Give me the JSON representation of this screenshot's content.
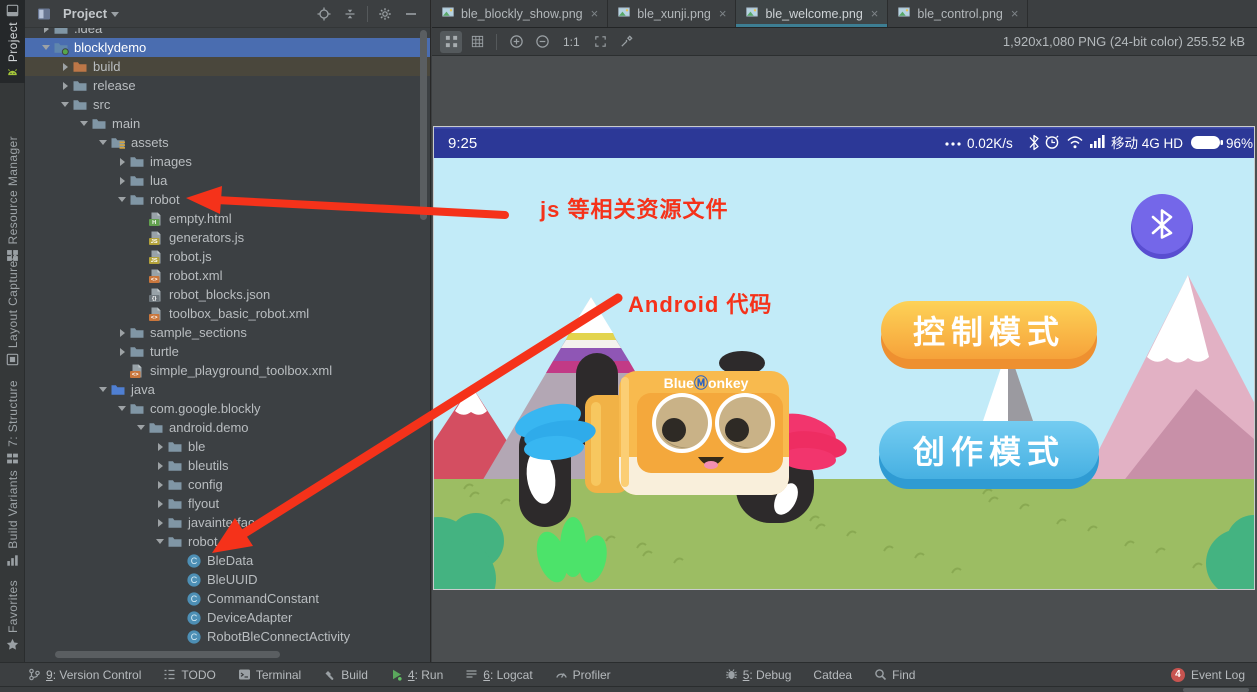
{
  "colors": {
    "annotation_red": "#f5321a",
    "selection_blue": "#4a6db0",
    "tab_underline_teal": "#3d7e93",
    "status_bar_indigo": "#2c3897",
    "button_orange": "#f6a73a",
    "button_blue": "#4cb4e5",
    "bluetooth_purple": "#7467e9",
    "event_badge_red": "#c75450"
  },
  "left_strip": {
    "items": [
      {
        "label": "Project",
        "icon": "android",
        "active": true
      },
      {
        "label": "Resource Manager",
        "icon": "resource-manager",
        "active": false
      },
      {
        "label": "Layout Captures",
        "icon": "layout-captures",
        "active": false
      },
      {
        "label": "7: Structure",
        "icon": "structure",
        "active": false
      },
      {
        "label": "Build Variants",
        "icon": "build-variants",
        "active": false
      },
      {
        "label": "Favorites",
        "icon": "favorites",
        "active": false
      }
    ]
  },
  "project_panel": {
    "title": "Project",
    "header_icons": [
      "locate",
      "collapse-all",
      "settings",
      "hide"
    ],
    "tree": [
      {
        "label": ".idea",
        "level": 0,
        "expand": "closed",
        "icon": "folder"
      },
      {
        "label": "blocklydemo",
        "level": 0,
        "expand": "open",
        "icon": "folder-root",
        "selected": true
      },
      {
        "label": "build",
        "level": 1,
        "expand": "closed",
        "icon": "folder-build",
        "rowbg": "build"
      },
      {
        "label": "release",
        "level": 1,
        "expand": "closed",
        "icon": "folder"
      },
      {
        "label": "src",
        "level": 1,
        "expand": "open",
        "icon": "folder"
      },
      {
        "label": "main",
        "level": 2,
        "expand": "open",
        "icon": "folder"
      },
      {
        "label": "assets",
        "level": 3,
        "expand": "open",
        "icon": "folder-assets"
      },
      {
        "label": "images",
        "level": 4,
        "expand": "closed",
        "icon": "folder"
      },
      {
        "label": "lua",
        "level": 4,
        "expand": "closed",
        "icon": "folder"
      },
      {
        "label": "robot",
        "level": 4,
        "expand": "open",
        "icon": "folder"
      },
      {
        "label": "empty.html",
        "level": 5,
        "expand": null,
        "icon": "file-html"
      },
      {
        "label": "generators.js",
        "level": 5,
        "expand": null,
        "icon": "file-js"
      },
      {
        "label": "robot.js",
        "level": 5,
        "expand": null,
        "icon": "file-js"
      },
      {
        "label": "robot.xml",
        "level": 5,
        "expand": null,
        "icon": "file-xml"
      },
      {
        "label": "robot_blocks.json",
        "level": 5,
        "expand": null,
        "icon": "file-json"
      },
      {
        "label": "toolbox_basic_robot.xml",
        "level": 5,
        "expand": null,
        "icon": "file-xml"
      },
      {
        "label": "sample_sections",
        "level": 4,
        "expand": "closed",
        "icon": "folder"
      },
      {
        "label": "turtle",
        "level": 4,
        "expand": "closed",
        "icon": "folder"
      },
      {
        "label": "simple_playground_toolbox.xml",
        "level": 4,
        "expand": null,
        "icon": "file-xml"
      },
      {
        "label": "java",
        "level": 3,
        "expand": "open",
        "icon": "folder-java"
      },
      {
        "label": "com.google.blockly",
        "level": 4,
        "expand": "open",
        "icon": "folder"
      },
      {
        "label": "android.demo",
        "level": 5,
        "expand": "open",
        "icon": "folder"
      },
      {
        "label": "ble",
        "level": 6,
        "expand": "closed",
        "icon": "folder"
      },
      {
        "label": "bleutils",
        "level": 6,
        "expand": "closed",
        "icon": "folder"
      },
      {
        "label": "config",
        "level": 6,
        "expand": "closed",
        "icon": "folder"
      },
      {
        "label": "flyout",
        "level": 6,
        "expand": "closed",
        "icon": "folder"
      },
      {
        "label": "javainterface",
        "level": 6,
        "expand": "closed",
        "icon": "folder"
      },
      {
        "label": "robot",
        "level": 6,
        "expand": "open",
        "icon": "folder"
      },
      {
        "label": "BleData",
        "level": 7,
        "expand": null,
        "icon": "class"
      },
      {
        "label": "BleUUID",
        "level": 7,
        "expand": null,
        "icon": "class"
      },
      {
        "label": "CommandConstant",
        "level": 7,
        "expand": null,
        "icon": "class"
      },
      {
        "label": "DeviceAdapter",
        "level": 7,
        "expand": null,
        "icon": "class"
      },
      {
        "label": "RobotBleConnectActivity",
        "level": 7,
        "expand": null,
        "icon": "class"
      }
    ]
  },
  "editor": {
    "tabs": [
      {
        "label": "ble_blockly_show.png",
        "active": false
      },
      {
        "label": "ble_xunji.png",
        "active": false
      },
      {
        "label": "ble_welcome.png",
        "active": true
      },
      {
        "label": "ble_control.png",
        "active": false
      }
    ],
    "toolbar": {
      "zoom_ratio": "1:1",
      "image_info": "1,920x1,080 PNG (24-bit color) 255.52 kB",
      "icons": [
        "zoom-to-fit",
        "grid",
        "zoom-in",
        "zoom-out",
        "actual-size",
        "frame",
        "color-picker"
      ]
    }
  },
  "phone": {
    "status_bar": {
      "time": "9:25",
      "net_speed": "0.02K/s",
      "carrier": "移动 4G HD",
      "battery_percent": "96%"
    },
    "logo": {
      "prefix": "Blue",
      "m": "Ⓜ",
      "suffix": "onkey"
    },
    "buttons": [
      {
        "label": "控制模式"
      },
      {
        "label": "创作模式"
      }
    ]
  },
  "annotations": [
    {
      "text": "js 等相关资源文件"
    },
    {
      "text": "Android 代码"
    }
  ],
  "bottom_bar": {
    "left": [
      {
        "icon": "branch",
        "mnemonic": "9",
        "label": "Version Control"
      },
      {
        "icon": "todo-list",
        "mnemonic": "",
        "label": "TODO"
      },
      {
        "icon": "terminal",
        "mnemonic": "",
        "label": "Terminal"
      },
      {
        "icon": "hammer",
        "mnemonic": "",
        "label": "Build"
      },
      {
        "icon": "run-play",
        "mnemonic": "4",
        "label": "Run"
      },
      {
        "icon": "logcat-lines",
        "mnemonic": "6",
        "label": "Logcat"
      },
      {
        "icon": "profiler-gauge",
        "mnemonic": "",
        "label": "Profiler"
      },
      {
        "icon": "debug-bug",
        "mnemonic": "5",
        "label": "Debug",
        "gap": true
      },
      {
        "icon": "",
        "mnemonic": "",
        "label": "Catdea"
      },
      {
        "icon": "search",
        "mnemonic": "",
        "label": "Find"
      }
    ],
    "event_log": {
      "badge": "4",
      "label": "Event Log"
    }
  }
}
